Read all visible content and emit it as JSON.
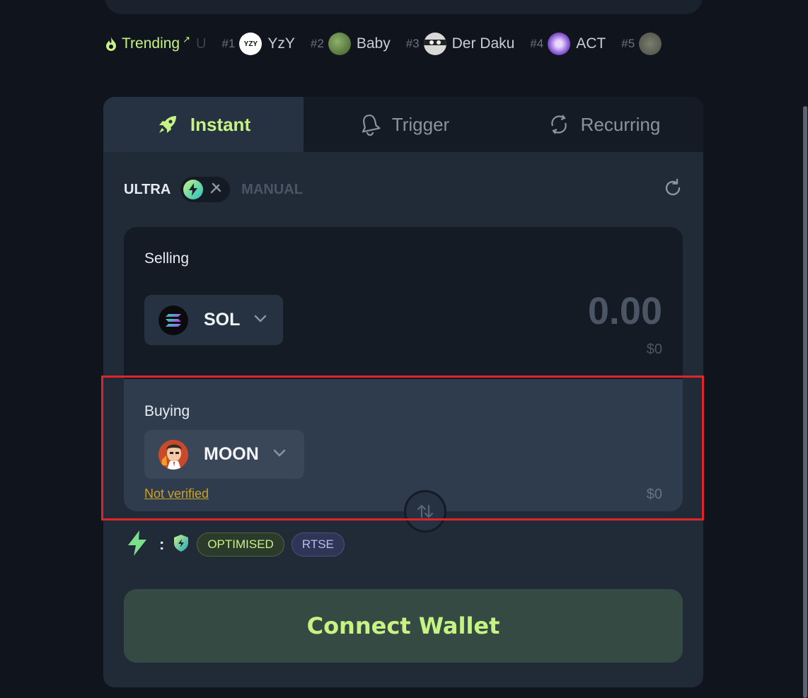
{
  "trending": {
    "label": "Trending",
    "faded_text": "U",
    "items": [
      {
        "rank": "#1",
        "name": "YzY",
        "avatar_text": "YZY"
      },
      {
        "rank": "#2",
        "name": "Baby"
      },
      {
        "rank": "#3",
        "name": "Der Daku"
      },
      {
        "rank": "#4",
        "name": "ACT"
      },
      {
        "rank": "#5",
        "name": ""
      }
    ]
  },
  "tabs": {
    "instant": "Instant",
    "trigger": "Trigger",
    "recurring": "Recurring"
  },
  "mode": {
    "ultra": "ULTRA",
    "manual": "MANUAL"
  },
  "selling": {
    "label": "Selling",
    "token": "SOL",
    "amount": "0.00",
    "usd": "$0"
  },
  "buying": {
    "label": "Buying",
    "token": "MOON",
    "verification": "Not verified",
    "usd": "$0"
  },
  "route": {
    "colon": ":",
    "badges": [
      "OPTIMISED",
      "RTSE"
    ]
  },
  "connect_wallet": "Connect Wallet",
  "colors": {
    "accent": "#c7f284",
    "background": "#0f141d",
    "card": "#212b38",
    "highlight": "#e0242b",
    "warning": "#c9a227"
  }
}
